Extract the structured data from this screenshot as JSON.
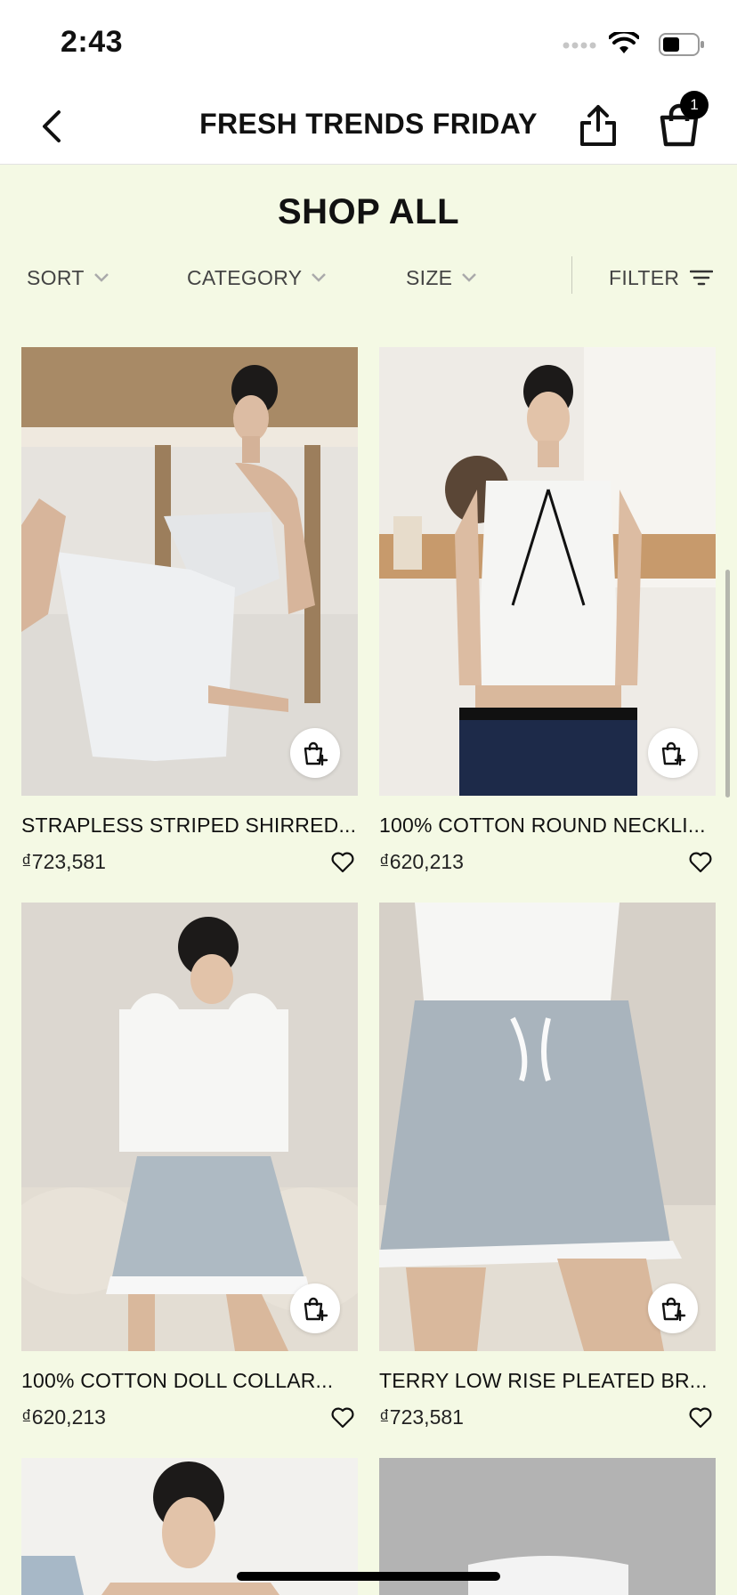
{
  "status": {
    "time": "2:43"
  },
  "nav": {
    "title": "FRESH TRENDS FRIDAY",
    "cart_count": "1"
  },
  "section": {
    "title": "SHOP ALL"
  },
  "filters": {
    "sort": "SORT",
    "category": "CATEGORY",
    "size": "SIZE",
    "filter": "FILTER"
  },
  "products": [
    {
      "name": "STRAPLESS STRIPED SHIRRED...",
      "price": "₫723,581"
    },
    {
      "name": "100% COTTON ROUND NECKLI...",
      "price": "₫620,213"
    },
    {
      "name": "100% COTTON DOLL COLLAR...",
      "price": "₫620,213"
    },
    {
      "name": "TERRY LOW RISE PLEATED BR...",
      "price": "₫723,581"
    }
  ],
  "colors": {
    "background": "#f4f9e4",
    "accent": "#000000"
  },
  "icons": {
    "back": "chevron-left-icon",
    "share": "share-icon",
    "bag": "shopping-bag-icon",
    "quick_add": "bag-plus-icon",
    "wishlist": "heart-icon",
    "filter": "filter-lines-icon"
  }
}
